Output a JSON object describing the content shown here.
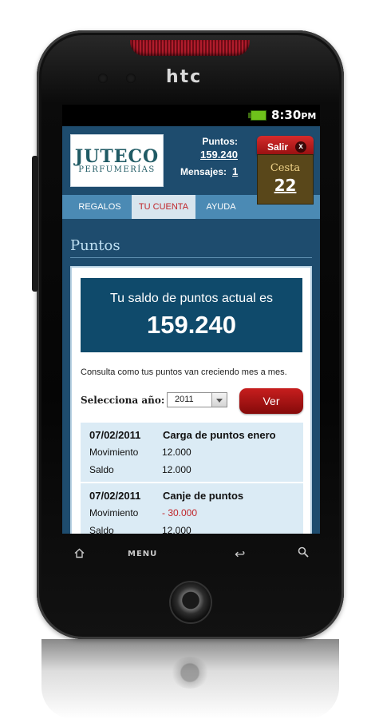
{
  "device": {
    "brand": "htc"
  },
  "statusbar": {
    "time": "8:30",
    "time_suffix": "PM",
    "battery_icon": "battery-icon"
  },
  "header": {
    "logo": {
      "name": "JUTECO",
      "subtitle": "PERFUMERÍAS"
    },
    "points_label": "Puntos:",
    "points_value": "159.240",
    "messages_label": "Mensajes:",
    "messages_value": "1",
    "logout_label": "Salir",
    "logout_close_glyph": "x",
    "cart_label": "Cesta",
    "cart_count": "22"
  },
  "nav": {
    "tabs": [
      {
        "label": "REGALOS",
        "active": false
      },
      {
        "label": "TU CUENTA",
        "active": true
      },
      {
        "label": "AYUDA",
        "active": false
      }
    ]
  },
  "main": {
    "title": "Puntos",
    "balance_text": "Tu saldo de puntos actual es",
    "balance_value": "159.240",
    "info_text": "Consulta como tus puntos van creciendo mes a mes.",
    "year_label": "Selecciona año:",
    "year_selected": "2011",
    "view_label": "Ver",
    "movements": [
      {
        "date": "07/02/2011",
        "title": "Carga de puntos enero",
        "movement_label": "Movimiento",
        "movement_value": "12.000",
        "balance_label": "Saldo",
        "balance_value": "12.000"
      },
      {
        "date": "07/02/2011",
        "title": "Canje de puntos",
        "movement_label": "Movimiento",
        "movement_value": "- 30.000",
        "balance_label": "Saldo",
        "balance_value": "12.000"
      }
    ]
  },
  "hardware_keys": {
    "menu_label": "MENU"
  },
  "colors": {
    "accent_red": "#c0262b",
    "header_blue": "#1e4c6e",
    "nav_blue": "#4b8ab4",
    "cart_brown": "#59471a"
  }
}
